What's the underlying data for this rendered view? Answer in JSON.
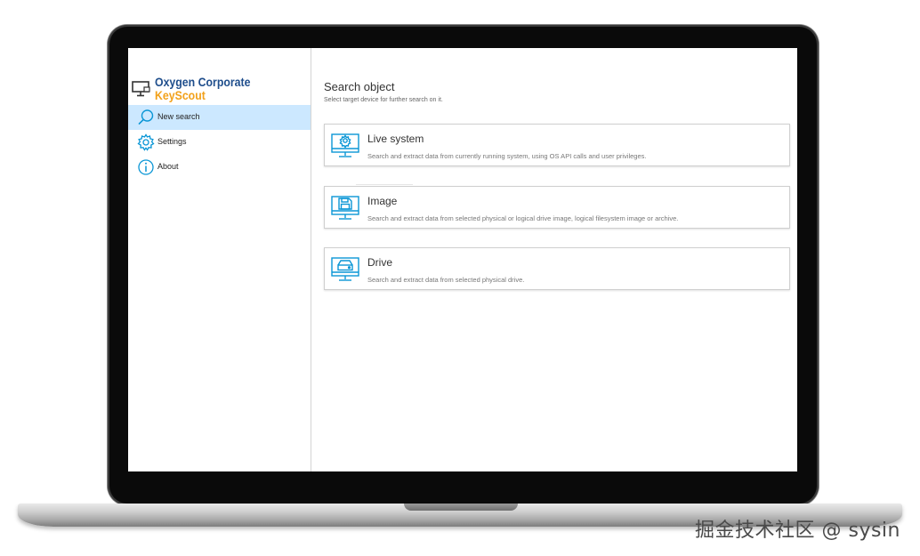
{
  "app": {
    "logo_line1": "Oxygen Corporate",
    "logo_line2": "KeyScout",
    "accent_color": "#0a96d6",
    "active_bg": "#cce8ff"
  },
  "sidebar": {
    "items": [
      {
        "label": "New search",
        "icon": "search-icon",
        "active": true
      },
      {
        "label": "Settings",
        "icon": "gear-icon",
        "active": false
      },
      {
        "label": "About",
        "icon": "info-icon",
        "active": false
      }
    ]
  },
  "main": {
    "title": "Search object",
    "subtitle": "Select target device for further search on it.",
    "cards": [
      {
        "title": "Live system",
        "description": "Search and extract data from currently running system, using OS API calls and user privileges.",
        "icon": "monitor-gear-icon"
      },
      {
        "title": "Image",
        "description": "Search and extract data from selected physical or logical drive image, logical filesystem image or archive.",
        "icon": "monitor-disk-image-icon"
      },
      {
        "title": "Drive",
        "description": "Search and extract data from selected physical drive.",
        "icon": "monitor-drive-icon"
      }
    ]
  },
  "watermark": "掘金技术社区 @ sysin"
}
